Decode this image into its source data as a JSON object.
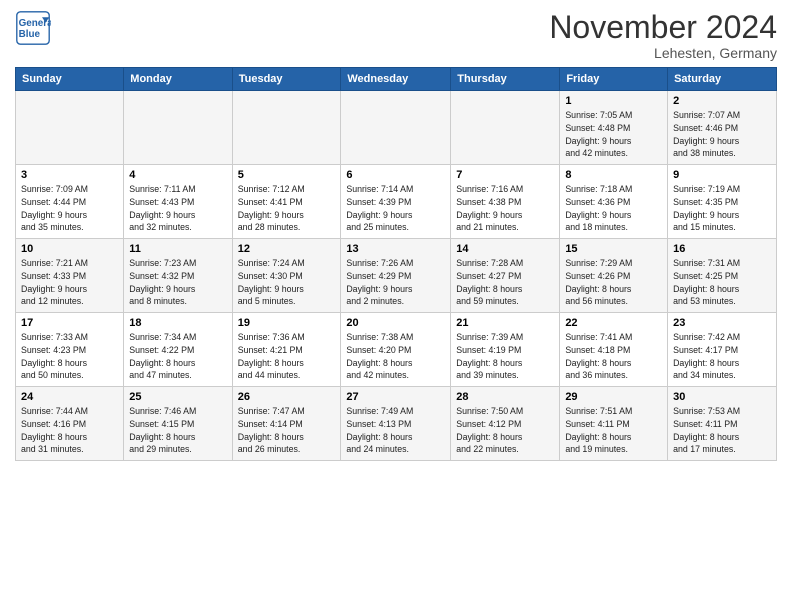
{
  "logo": {
    "text_general": "General",
    "text_blue": "Blue"
  },
  "title": "November 2024",
  "location": "Lehesten, Germany",
  "days_of_week": [
    "Sunday",
    "Monday",
    "Tuesday",
    "Wednesday",
    "Thursday",
    "Friday",
    "Saturday"
  ],
  "weeks": [
    [
      {
        "day": "",
        "info": ""
      },
      {
        "day": "",
        "info": ""
      },
      {
        "day": "",
        "info": ""
      },
      {
        "day": "",
        "info": ""
      },
      {
        "day": "",
        "info": ""
      },
      {
        "day": "1",
        "info": "Sunrise: 7:05 AM\nSunset: 4:48 PM\nDaylight: 9 hours\nand 42 minutes."
      },
      {
        "day": "2",
        "info": "Sunrise: 7:07 AM\nSunset: 4:46 PM\nDaylight: 9 hours\nand 38 minutes."
      }
    ],
    [
      {
        "day": "3",
        "info": "Sunrise: 7:09 AM\nSunset: 4:44 PM\nDaylight: 9 hours\nand 35 minutes."
      },
      {
        "day": "4",
        "info": "Sunrise: 7:11 AM\nSunset: 4:43 PM\nDaylight: 9 hours\nand 32 minutes."
      },
      {
        "day": "5",
        "info": "Sunrise: 7:12 AM\nSunset: 4:41 PM\nDaylight: 9 hours\nand 28 minutes."
      },
      {
        "day": "6",
        "info": "Sunrise: 7:14 AM\nSunset: 4:39 PM\nDaylight: 9 hours\nand 25 minutes."
      },
      {
        "day": "7",
        "info": "Sunrise: 7:16 AM\nSunset: 4:38 PM\nDaylight: 9 hours\nand 21 minutes."
      },
      {
        "day": "8",
        "info": "Sunrise: 7:18 AM\nSunset: 4:36 PM\nDaylight: 9 hours\nand 18 minutes."
      },
      {
        "day": "9",
        "info": "Sunrise: 7:19 AM\nSunset: 4:35 PM\nDaylight: 9 hours\nand 15 minutes."
      }
    ],
    [
      {
        "day": "10",
        "info": "Sunrise: 7:21 AM\nSunset: 4:33 PM\nDaylight: 9 hours\nand 12 minutes."
      },
      {
        "day": "11",
        "info": "Sunrise: 7:23 AM\nSunset: 4:32 PM\nDaylight: 9 hours\nand 8 minutes."
      },
      {
        "day": "12",
        "info": "Sunrise: 7:24 AM\nSunset: 4:30 PM\nDaylight: 9 hours\nand 5 minutes."
      },
      {
        "day": "13",
        "info": "Sunrise: 7:26 AM\nSunset: 4:29 PM\nDaylight: 9 hours\nand 2 minutes."
      },
      {
        "day": "14",
        "info": "Sunrise: 7:28 AM\nSunset: 4:27 PM\nDaylight: 8 hours\nand 59 minutes."
      },
      {
        "day": "15",
        "info": "Sunrise: 7:29 AM\nSunset: 4:26 PM\nDaylight: 8 hours\nand 56 minutes."
      },
      {
        "day": "16",
        "info": "Sunrise: 7:31 AM\nSunset: 4:25 PM\nDaylight: 8 hours\nand 53 minutes."
      }
    ],
    [
      {
        "day": "17",
        "info": "Sunrise: 7:33 AM\nSunset: 4:23 PM\nDaylight: 8 hours\nand 50 minutes."
      },
      {
        "day": "18",
        "info": "Sunrise: 7:34 AM\nSunset: 4:22 PM\nDaylight: 8 hours\nand 47 minutes."
      },
      {
        "day": "19",
        "info": "Sunrise: 7:36 AM\nSunset: 4:21 PM\nDaylight: 8 hours\nand 44 minutes."
      },
      {
        "day": "20",
        "info": "Sunrise: 7:38 AM\nSunset: 4:20 PM\nDaylight: 8 hours\nand 42 minutes."
      },
      {
        "day": "21",
        "info": "Sunrise: 7:39 AM\nSunset: 4:19 PM\nDaylight: 8 hours\nand 39 minutes."
      },
      {
        "day": "22",
        "info": "Sunrise: 7:41 AM\nSunset: 4:18 PM\nDaylight: 8 hours\nand 36 minutes."
      },
      {
        "day": "23",
        "info": "Sunrise: 7:42 AM\nSunset: 4:17 PM\nDaylight: 8 hours\nand 34 minutes."
      }
    ],
    [
      {
        "day": "24",
        "info": "Sunrise: 7:44 AM\nSunset: 4:16 PM\nDaylight: 8 hours\nand 31 minutes."
      },
      {
        "day": "25",
        "info": "Sunrise: 7:46 AM\nSunset: 4:15 PM\nDaylight: 8 hours\nand 29 minutes."
      },
      {
        "day": "26",
        "info": "Sunrise: 7:47 AM\nSunset: 4:14 PM\nDaylight: 8 hours\nand 26 minutes."
      },
      {
        "day": "27",
        "info": "Sunrise: 7:49 AM\nSunset: 4:13 PM\nDaylight: 8 hours\nand 24 minutes."
      },
      {
        "day": "28",
        "info": "Sunrise: 7:50 AM\nSunset: 4:12 PM\nDaylight: 8 hours\nand 22 minutes."
      },
      {
        "day": "29",
        "info": "Sunrise: 7:51 AM\nSunset: 4:11 PM\nDaylight: 8 hours\nand 19 minutes."
      },
      {
        "day": "30",
        "info": "Sunrise: 7:53 AM\nSunset: 4:11 PM\nDaylight: 8 hours\nand 17 minutes."
      }
    ]
  ]
}
